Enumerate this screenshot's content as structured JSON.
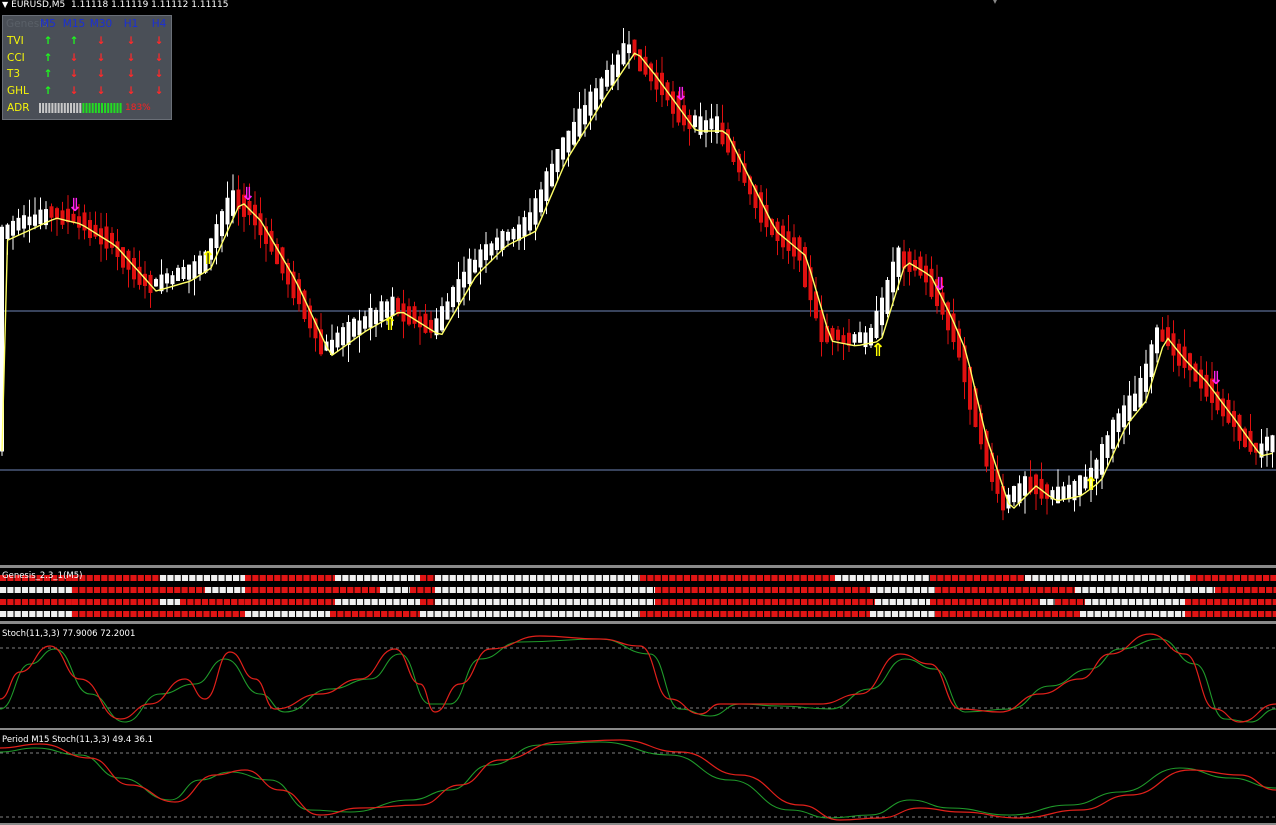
{
  "header": {
    "symbol": "EURUSD,M5",
    "quotes": "1.11118 1.11119 1.11112 1.11115"
  },
  "panel": {
    "title": "Genesis",
    "timeframes": [
      "M5",
      "M15",
      "M30",
      "H1",
      "H4"
    ],
    "rows": [
      {
        "label": "TVI",
        "signals": [
          "up",
          "up",
          "down",
          "down",
          "down"
        ]
      },
      {
        "label": "CCI",
        "signals": [
          "up",
          "down",
          "down",
          "down",
          "down"
        ]
      },
      {
        "label": "T3",
        "signals": [
          "up",
          "down",
          "down",
          "down",
          "down"
        ]
      },
      {
        "label": "GHL",
        "signals": [
          "up",
          "down",
          "down",
          "down",
          "down"
        ]
      }
    ],
    "adr": {
      "label": "ADR",
      "gray_segments": 14,
      "green_segments": 13,
      "value": "183%"
    }
  },
  "arrows": {
    "up_glyph": "🡅",
    "down_glyph": "🡇",
    "up_icon": "arrow-up-icon",
    "down_icon": "arrow-down-icon"
  },
  "colors": {
    "bull": "#ffffff",
    "bear": "#e01010",
    "ma": "#ffff66",
    "sell_arrow": "#ff22ee",
    "buy_arrow": "#ffff00",
    "hline": "#6f86b8",
    "stoch_main": "#e0201a",
    "stoch_signal": "#1f9a2a"
  },
  "indicators": {
    "genesis_title": "Genesis_2.3_1(M5)",
    "stoch_title": "Stoch(11,3,3) 77.9006 72.2001",
    "m15_title": "Period M15 Stoch(11,3,3) 49.4 36.1"
  },
  "chart_data": {
    "type": "candlestick",
    "symbol": "EURUSD",
    "timeframe": "M5",
    "ohlc": [
      1.11118,
      1.11119,
      1.11112,
      1.11115
    ],
    "stochastic": {
      "k": 77.9006,
      "d": 72.2001
    },
    "m15_stochastic": {
      "k": 49.4,
      "d": 36.1
    }
  }
}
